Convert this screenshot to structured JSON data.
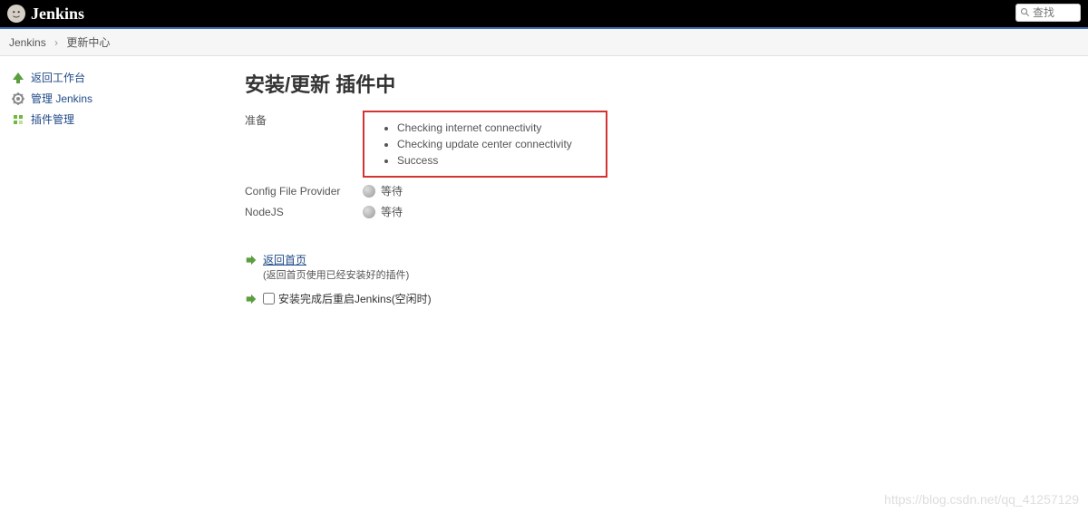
{
  "header": {
    "logo_text": "Jenkins",
    "search_placeholder": "查找"
  },
  "breadcrumb": {
    "items": [
      "Jenkins",
      "更新中心"
    ]
  },
  "sidebar": {
    "items": [
      {
        "label": "返回工作台",
        "icon": "up-arrow"
      },
      {
        "label": "管理 Jenkins",
        "icon": "gear"
      },
      {
        "label": "插件管理",
        "icon": "plugin"
      }
    ]
  },
  "main": {
    "title": "安装/更新 插件中",
    "prepare_label": "准备",
    "prepare_items": [
      "Checking internet connectivity",
      "Checking update center connectivity",
      "Success"
    ],
    "install_rows": [
      {
        "name": "Config File Provider",
        "status": "等待"
      },
      {
        "name": "NodeJS",
        "status": "等待"
      }
    ],
    "back_link_label": "返回首页",
    "back_link_sub": "(返回首页使用已经安装好的插件)",
    "restart_checkbox_label": "安装完成后重启Jenkins(空闲时)"
  },
  "watermark": "https://blog.csdn.net/qq_41257129"
}
